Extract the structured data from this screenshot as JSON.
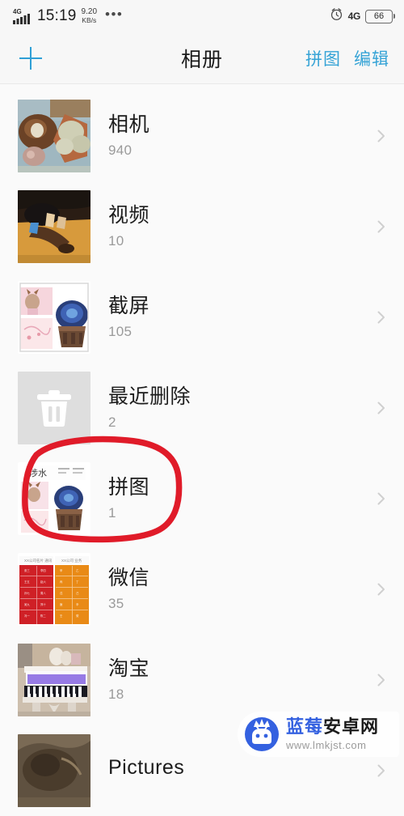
{
  "status_bar": {
    "network_type": "4G",
    "time": "15:19",
    "net_speed_value": "9.20",
    "net_speed_unit": "KB/s",
    "overflow_dots": "•••",
    "alarm_icon": "alarm-clock-icon",
    "signal_icon": "signal-bars-icon",
    "right_network_type": "4G",
    "battery_level": "66"
  },
  "header": {
    "add_icon": "plus-icon",
    "title": "相册",
    "action_collage": "拼图",
    "action_edit": "编辑"
  },
  "albums": [
    {
      "name": "相机",
      "count": "940",
      "thumb": "photo-mushrooms",
      "chevron": "chevron-right-icon"
    },
    {
      "name": "视频",
      "count": "10",
      "thumb": "photo-legs",
      "chevron": "chevron-right-icon"
    },
    {
      "name": "截屏",
      "count": "105",
      "thumb": "photo-collage",
      "chevron": "chevron-right-icon"
    },
    {
      "name": "最近删除",
      "count": "2",
      "thumb": "trash-icon",
      "chevron": "chevron-right-icon"
    },
    {
      "name": "拼图",
      "count": "1",
      "thumb": "photo-puzzle",
      "chevron": "chevron-right-icon"
    },
    {
      "name": "微信",
      "count": "35",
      "thumb": "photo-redorange",
      "chevron": "chevron-right-icon"
    },
    {
      "name": "淘宝",
      "count": "18",
      "thumb": "photo-piano",
      "chevron": "chevron-right-icon"
    },
    {
      "name": "Pictures",
      "count": "",
      "thumb": "photo-dark",
      "chevron": "chevron-right-icon"
    }
  ],
  "annotation": {
    "shape": "hand-drawn-red-circle",
    "target": "拼图",
    "color": "#e01b29"
  },
  "watermark": {
    "logo_icon": "blueberry-android-logo",
    "name_primary": "蓝莓",
    "name_secondary": "安卓网",
    "url": "www.lmkjst.com"
  },
  "colors": {
    "accent": "#35a3d6",
    "background": "#f7f7f7",
    "title_text": "#1c1c1c",
    "count_text": "#9a9a9a",
    "annotation_red": "#e01b29",
    "watermark_blue": "#3461e0"
  }
}
